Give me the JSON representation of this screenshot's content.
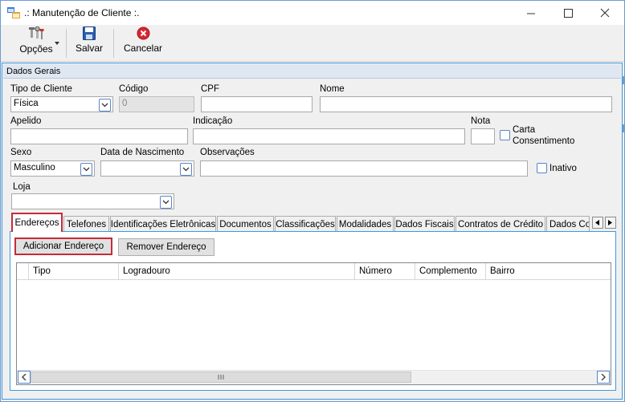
{
  "window": {
    "title": ".: Manutenção de Cliente :.",
    "controls": {
      "minimize": "—",
      "maximize": "☐",
      "close": "✕"
    }
  },
  "toolbar": {
    "options_label": "Opções",
    "save_label": "Salvar",
    "cancel_label": "Cancelar"
  },
  "group": {
    "title": "Dados Gerais"
  },
  "form": {
    "tipo_cliente_label": "Tipo de Cliente",
    "tipo_cliente_value": "Física",
    "codigo_label": "Código",
    "codigo_value": "0",
    "cpf_label": "CPF",
    "cpf_value": "",
    "nome_label": "Nome",
    "nome_value": "",
    "apelido_label": "Apelido",
    "apelido_value": "",
    "indicacao_label": "Indicação",
    "indicacao_value": "",
    "nota_label": "Nota",
    "nota_value": "",
    "carta_label_line1": "Carta",
    "carta_label_line2": "Consentimento",
    "sexo_label": "Sexo",
    "sexo_value": "Masculino",
    "nascimento_label": "Data de Nascimento",
    "nascimento_value": "",
    "observacoes_label": "Observações",
    "observacoes_value": "",
    "inativo_label": "Inativo",
    "loja_label": "Loja",
    "loja_value": ""
  },
  "tabs": [
    {
      "label": "Endereços"
    },
    {
      "label": "Telefones"
    },
    {
      "label": "Identificações Eletrônicas"
    },
    {
      "label": "Documentos"
    },
    {
      "label": "Classificações"
    },
    {
      "label": "Modalidades"
    },
    {
      "label": "Dados Fiscais"
    },
    {
      "label": "Contratos de Crédito"
    },
    {
      "label": "Dados Co"
    }
  ],
  "enderecos": {
    "add_button": "Adicionar Endereço",
    "remove_button": "Remover Endereço",
    "columns": [
      "Tipo",
      "Logradouro",
      "Número",
      "Complemento",
      "Bairro"
    ],
    "rows": []
  },
  "colors": {
    "accent_border": "#3c9ae0",
    "highlight_red": "#c42b3a",
    "cancel_red": "#d9262f",
    "save_blue": "#2a5fb0"
  },
  "icons": {
    "options": "tools-icon",
    "save": "floppy-disk-icon",
    "cancel": "cancel-circle-icon"
  }
}
